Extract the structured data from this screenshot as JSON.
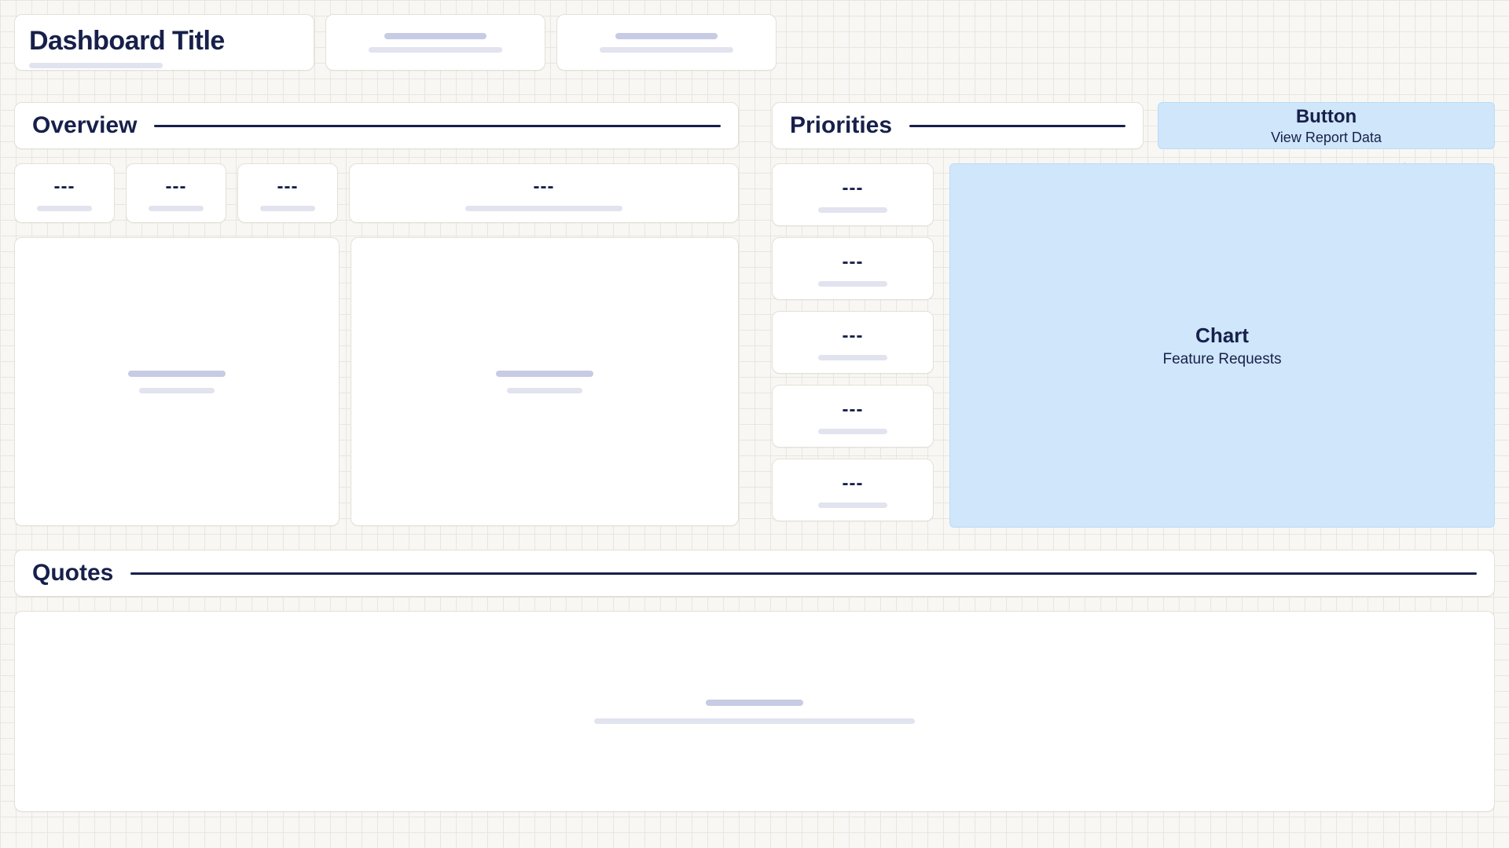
{
  "header": {
    "title": "Dashboard Title"
  },
  "overview": {
    "heading": "Overview",
    "stats": [
      "---",
      "---",
      "---",
      "---"
    ]
  },
  "priorities": {
    "heading": "Priorities",
    "items": [
      "---",
      "---",
      "---",
      "---",
      "---"
    ]
  },
  "button": {
    "type_label": "Button",
    "label": "View Report Data"
  },
  "chart": {
    "type_label": "Chart",
    "label": "Feature Requests"
  },
  "quotes": {
    "heading": "Quotes"
  }
}
